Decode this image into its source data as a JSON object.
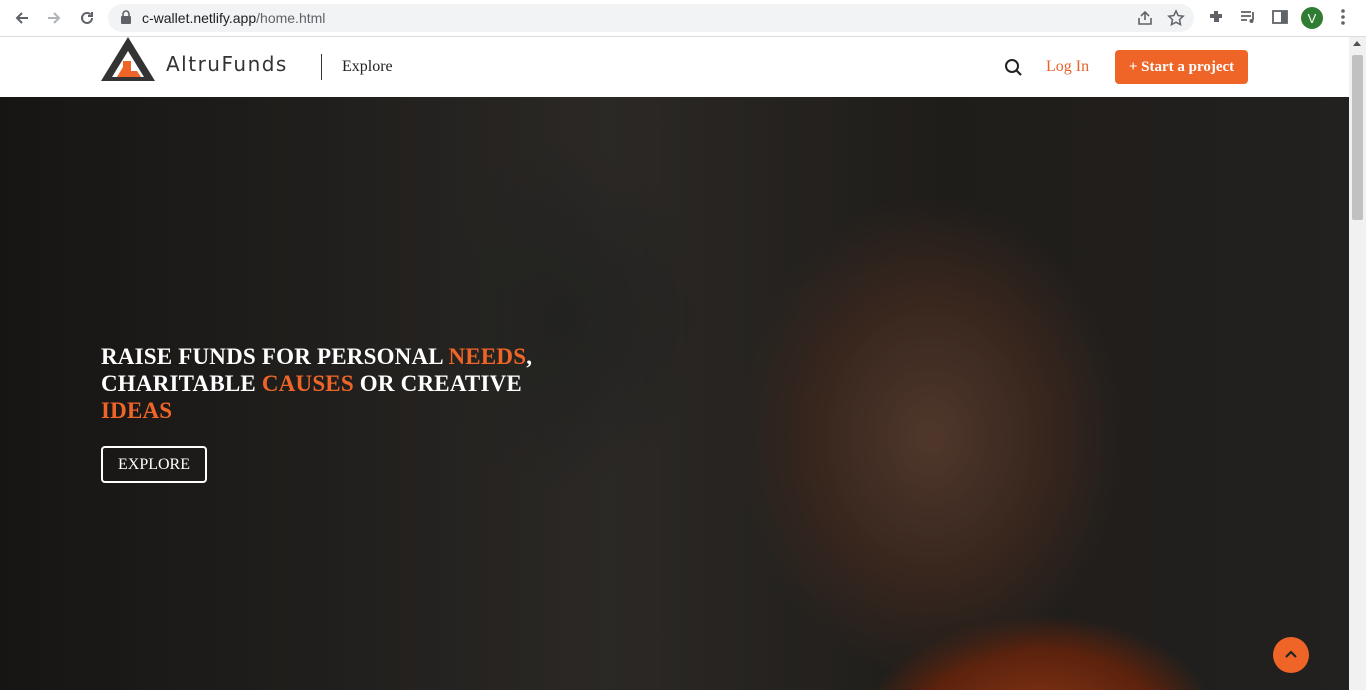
{
  "browser": {
    "url_host": "c-wallet.netlify.app",
    "url_path": "/home.html",
    "profile_initial": "V"
  },
  "header": {
    "brand": "AltruFunds",
    "explore": "Explore",
    "login": "Log In",
    "start_project": "+ Start a project"
  },
  "hero": {
    "line1_a": "RAISE FUNDS FOR PERSONAL ",
    "line1_accent": "NEEDS",
    "line1_b": ",",
    "line2_a": "CHARITABLE ",
    "line2_accent": "CAUSES",
    "line2_b": " OR CREATIVE",
    "line3_accent": "IDEAS",
    "explore_button": "EXPLORE"
  },
  "colors": {
    "accent": "#ef6528",
    "text_dark": "#333333"
  },
  "icons": [
    "back-icon",
    "forward-icon",
    "reload-icon",
    "lock-icon",
    "share-icon",
    "star-icon",
    "extensions-icon",
    "media-icon",
    "side-panel-icon",
    "menu-icon",
    "search-icon",
    "chevron-up-icon"
  ]
}
